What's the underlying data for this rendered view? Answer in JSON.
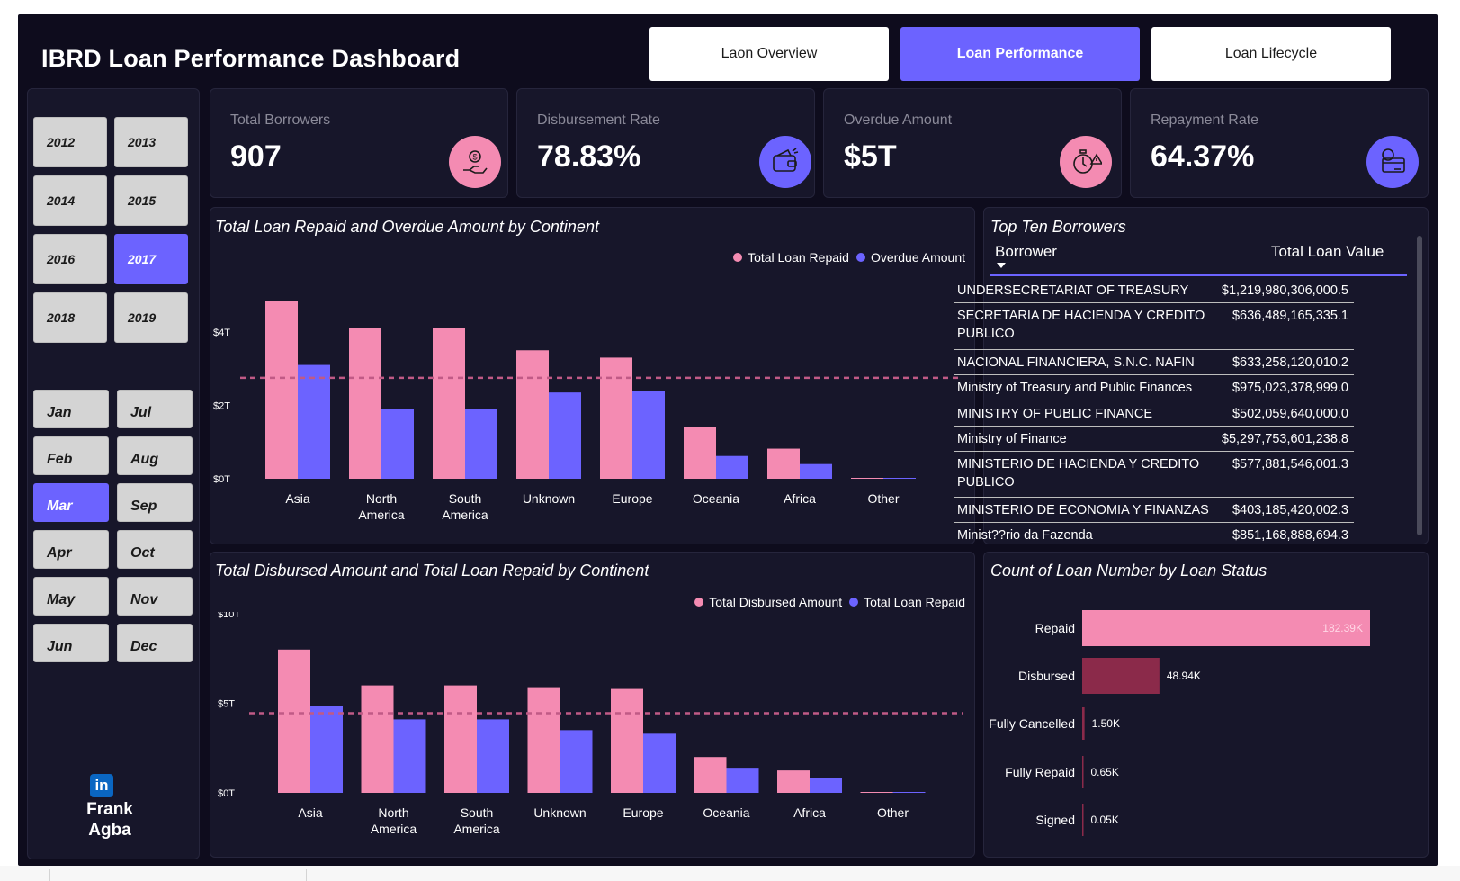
{
  "title": "IBRD Loan Performance Dashboard",
  "nav": [
    {
      "label": "Laon Overview",
      "active": false
    },
    {
      "label": "Loan Performance",
      "active": true
    },
    {
      "label": "Loan Lifecycle",
      "active": false
    }
  ],
  "years": {
    "items": [
      "2012",
      "2013",
      "2014",
      "2015",
      "2016",
      "2017",
      "2018",
      "2019"
    ],
    "selected": "2017"
  },
  "months": {
    "items": [
      "Jan",
      "Jul",
      "Feb",
      "Aug",
      "Mar",
      "Sep",
      "Apr",
      "Oct",
      "May",
      "Nov",
      "Jun",
      "Dec"
    ],
    "selected": "Mar"
  },
  "author": {
    "first": "Frank",
    "last": "Agba",
    "icon": "linkedin-icon"
  },
  "kpis": [
    {
      "label": "Total Borrowers",
      "value": "907",
      "icon": "borrower-icon",
      "icon_color": "#f48bb2"
    },
    {
      "label": "Disbursement Rate",
      "value": "78.83%",
      "icon": "wallet-icon",
      "icon_color": "#6c63ff"
    },
    {
      "label": "Overdue Amount",
      "value": "$5T",
      "icon": "overdue-clock-icon",
      "icon_color": "#f48bb2"
    },
    {
      "label": "Repayment Rate",
      "value": "64.37%",
      "icon": "repayment-card-icon",
      "icon_color": "#6c63ff"
    }
  ],
  "colors": {
    "pink": "#f48bb2",
    "purple": "#6c63ff",
    "maroon": "#8b2a4a",
    "background": "#0e0c1d",
    "panel": "#17162a"
  },
  "chart_data": [
    {
      "type": "bar",
      "title": "Total Loan Repaid and Overdue Amount by Continent",
      "categories": [
        "Asia",
        "North America",
        "South America",
        "Unknown",
        "Europe",
        "Oceania",
        "Africa",
        "Other"
      ],
      "series": [
        {
          "name": "Total Loan Repaid",
          "values": [
            4.85,
            4.1,
            4.1,
            3.5,
            3.3,
            1.4,
            0.82,
            0.02
          ]
        },
        {
          "name": "Overdue Amount",
          "values": [
            3.1,
            1.9,
            1.9,
            2.35,
            2.4,
            0.62,
            0.4,
            0.02
          ]
        }
      ],
      "yticks": [
        "$0T",
        "$2T",
        "$4T"
      ],
      "ylim": [
        0,
        5.1
      ],
      "reference_line": 2.75,
      "legend_position": "top-right"
    },
    {
      "type": "bar",
      "title": "Total Disbursed Amount and Total Loan Repaid by Continent",
      "categories": [
        "Asia",
        "North America",
        "South America",
        "Unknown",
        "Europe",
        "Oceania",
        "Africa",
        "Other"
      ],
      "series": [
        {
          "name": "Total Disbursed Amount",
          "values": [
            8.0,
            6.0,
            6.0,
            5.9,
            5.8,
            2.0,
            1.25,
            0.05
          ]
        },
        {
          "name": "Total Loan Repaid",
          "values": [
            4.85,
            4.1,
            4.1,
            3.5,
            3.3,
            1.4,
            0.82,
            0.02
          ]
        }
      ],
      "yticks": [
        "$0T",
        "$5T",
        "$10T"
      ],
      "ylim": [
        0,
        10
      ],
      "reference_line": 4.45,
      "legend_position": "top-right"
    },
    {
      "type": "bar",
      "orientation": "horizontal",
      "title": "Count of Loan Number by Loan Status",
      "categories": [
        "Repaid",
        "Disbursed",
        "Fully Cancelled",
        "Fully Repaid",
        "Signed"
      ],
      "values": [
        182.39,
        48.94,
        1.5,
        0.65,
        0.05
      ],
      "labels": [
        "182.39K",
        "48.94K",
        "1.50K",
        "0.65K",
        "0.05K"
      ]
    }
  ],
  "top_borrowers": {
    "title": "Top Ten Borrowers",
    "col_borrower": "Borrower",
    "col_value": "Total Loan Value",
    "rows": [
      {
        "borrower": "UNDERSECRETARIAT OF TREASURY",
        "value": "$1,219,980,306,000.5"
      },
      {
        "borrower": "SECRETARIA DE HACIENDA Y CREDITO PUBLICO",
        "value": "$636,489,165,335.1"
      },
      {
        "borrower": "NACIONAL FINANCIERA, S.N.C. NAFIN",
        "value": "$633,258,120,010.2"
      },
      {
        "borrower": "Ministry of Treasury and Public Finances",
        "value": "$975,023,378,999.0"
      },
      {
        "borrower": "MINISTRY OF PUBLIC FINANCE",
        "value": "$502,059,640,000.0"
      },
      {
        "borrower": "Ministry of Finance",
        "value": "$5,297,753,601,238.8"
      },
      {
        "borrower": "MINISTERIO DE HACIENDA Y CREDITO PUBLICO",
        "value": "$577,881,546,001.3"
      },
      {
        "borrower": "MINISTERIO DE ECONOMIA Y FINANZAS",
        "value": "$403,185,420,002.3"
      },
      {
        "borrower": "Minist??rio da Fazenda",
        "value": "$851,168,888,694.3"
      }
    ]
  }
}
